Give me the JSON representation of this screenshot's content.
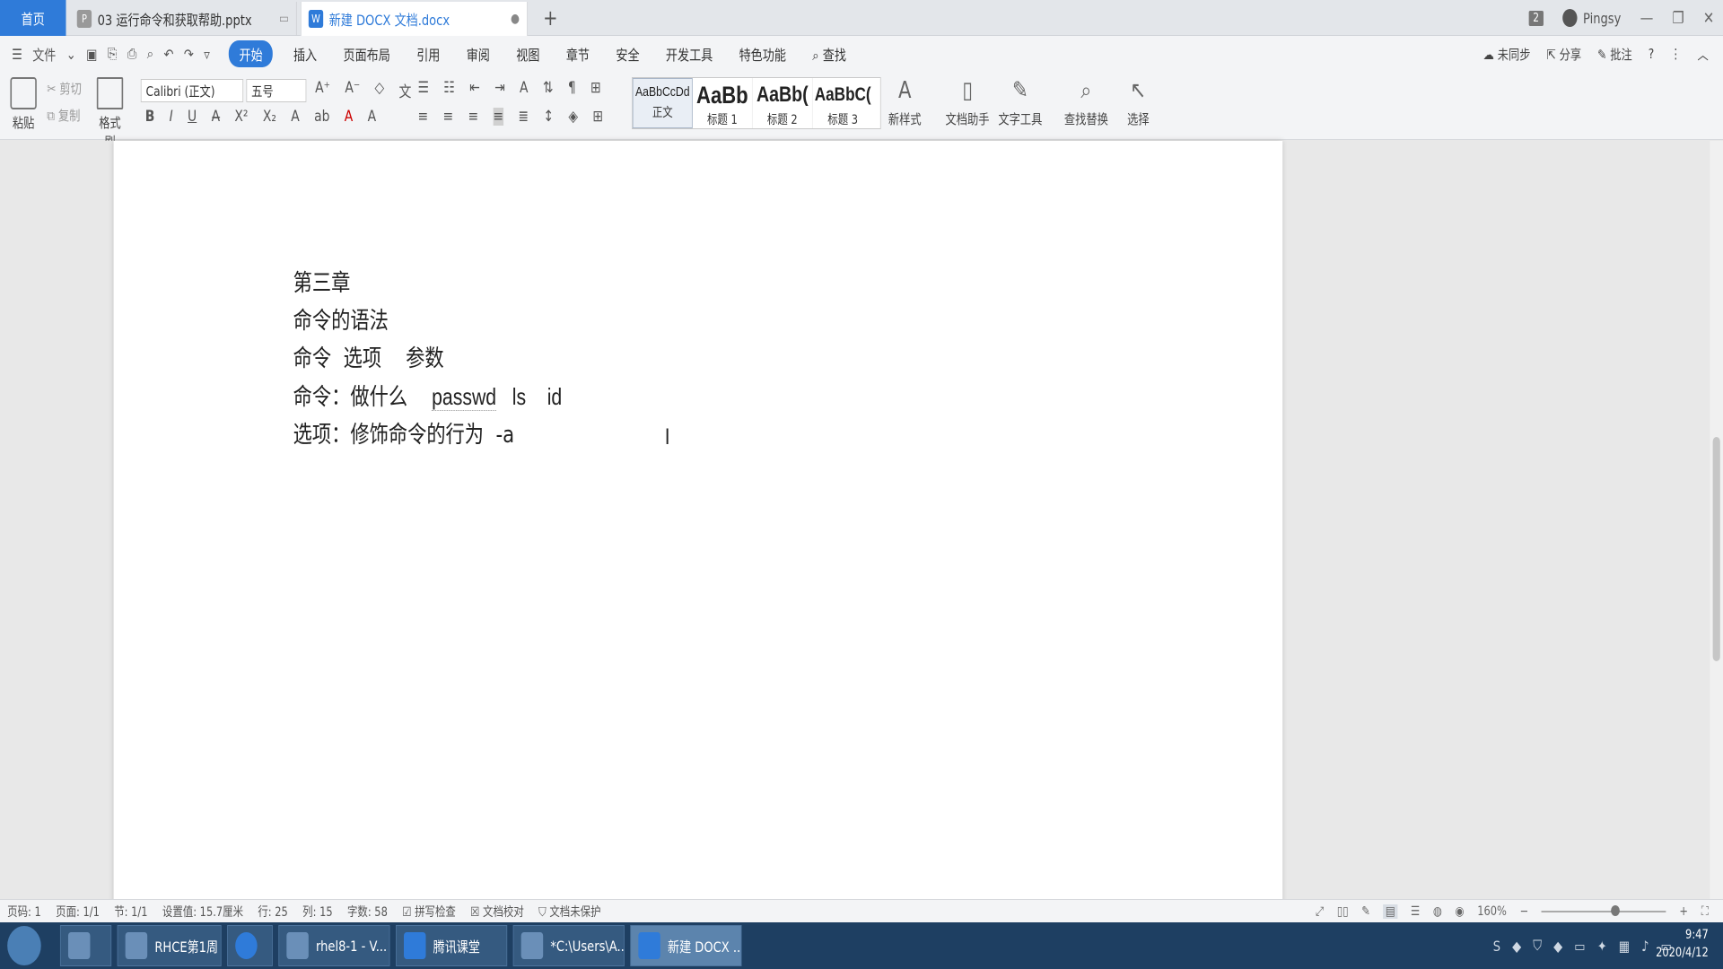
{
  "tabs": {
    "home": "首页",
    "doc1": "03 运行命令和获取帮助.pptx",
    "doc2": "新建 DOCX 文档.docx",
    "new": "+"
  },
  "window": {
    "badge": "2",
    "user": "Pingsy"
  },
  "menu": {
    "file": "文件",
    "items": [
      "开始",
      "插入",
      "页面布局",
      "引用",
      "审阅",
      "视图",
      "章节",
      "安全",
      "开发工具",
      "特色功能"
    ],
    "search": "查找",
    "sync": "未同步",
    "share": "分享",
    "comment": "批注"
  },
  "ribbon": {
    "paste": "粘贴",
    "cut": "剪切",
    "copy": "复制",
    "format_painter": "格式刷",
    "font_name": "Calibri (正文)",
    "font_size": "五号",
    "styles": [
      {
        "preview": "AaBbCcDd",
        "name": "正文"
      },
      {
        "preview": "AaBb",
        "name": "标题 1"
      },
      {
        "preview": "AaBb(",
        "name": "标题 2"
      },
      {
        "preview": "AaBbC(",
        "name": "标题 3"
      }
    ],
    "new_style": "新样式",
    "doc_helper": "文档助手",
    "text_tools": "文字工具",
    "find_replace": "查找替换",
    "select": "选择"
  },
  "document": {
    "lines": [
      "第三章",
      "命令的语法",
      "命令  选项    参数"
    ],
    "line4_prefix": "命令：做什么    ",
    "line4_word1": "passwd",
    "line4_rest": "   ls    id",
    "line5": "选项：修饰命令的行为  -a"
  },
  "status": {
    "page_no": "页码: 1",
    "pages": "页面: 1/1",
    "section": "节: 1/1",
    "setting": "设置值: 15.7厘米",
    "row": "行: 25",
    "col": "列: 15",
    "words": "字数: 58",
    "spell": "拼写检查",
    "proof": "文档校对",
    "protect": "文档未保护",
    "zoom": "160%"
  },
  "taskbar": {
    "items": [
      "RHCE第1周",
      "rhel8-1 - V...",
      "腾讯课堂",
      "*C:\\Users\\A...",
      "新建 DOCX ..."
    ],
    "time": "9:47",
    "date": "2020/4/12"
  }
}
